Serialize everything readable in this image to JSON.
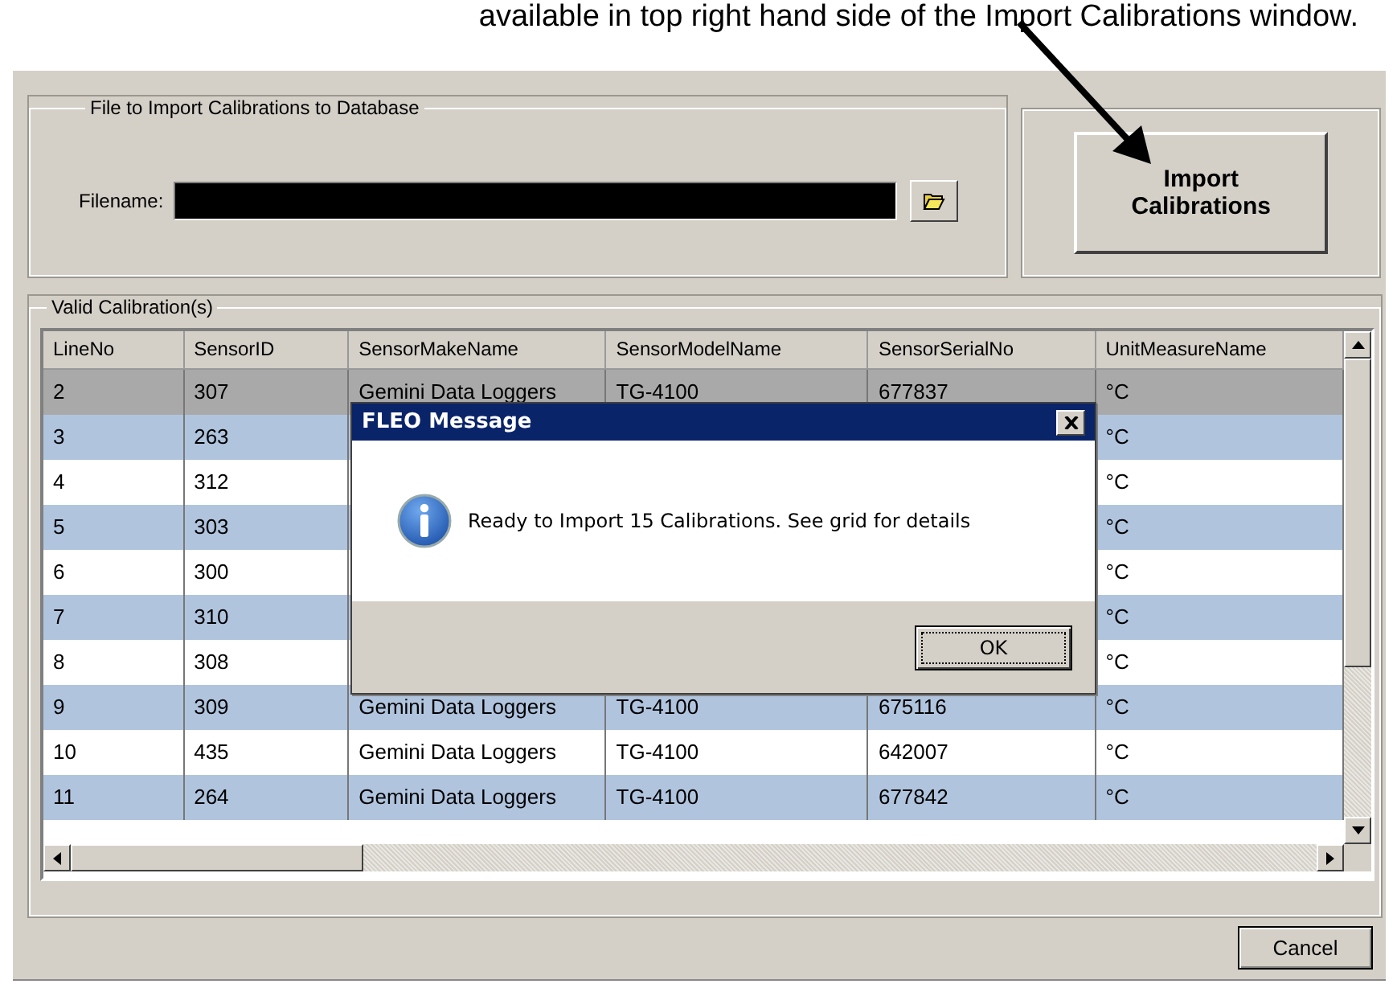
{
  "caption": "available in top right hand side of the Import Calibrations window.",
  "file_group": {
    "title": "File to Import Calibrations to Database",
    "label": "Filename:"
  },
  "import_button": "Import Calibrations",
  "grid_group": {
    "title": "Valid Calibration(s)"
  },
  "table": {
    "columns": [
      "LineNo",
      "SensorID",
      "SensorMakeName",
      "SensorModelName",
      "SensorSerialNo",
      "UnitMeasureName"
    ],
    "rows": [
      {
        "cells": [
          "2",
          "307",
          "Gemini Data Loggers",
          "TG-4100",
          "677837",
          "°C"
        ],
        "selected": true
      },
      {
        "cells": [
          "3",
          "263",
          null,
          null,
          null,
          "°C"
        ],
        "selected": false
      },
      {
        "cells": [
          "4",
          "312",
          null,
          null,
          null,
          "°C"
        ],
        "selected": false
      },
      {
        "cells": [
          "5",
          "303",
          null,
          null,
          null,
          "°C"
        ],
        "selected": false
      },
      {
        "cells": [
          "6",
          "300",
          null,
          null,
          null,
          "°C"
        ],
        "selected": false
      },
      {
        "cells": [
          "7",
          "310",
          null,
          null,
          null,
          "°C"
        ],
        "selected": false
      },
      {
        "cells": [
          "8",
          "308",
          null,
          null,
          null,
          "°C"
        ],
        "selected": false
      },
      {
        "cells": [
          "9",
          "309",
          "Gemini Data Loggers",
          "TG-4100",
          "675116",
          "°C"
        ],
        "selected": false
      },
      {
        "cells": [
          "10",
          "435",
          "Gemini Data Loggers",
          "TG-4100",
          "642007",
          "°C"
        ],
        "selected": false
      },
      {
        "cells": [
          "11",
          "264",
          "Gemini Data Loggers",
          "TG-4100",
          "677842",
          "°C"
        ],
        "selected": false
      }
    ]
  },
  "cancel_button": "Cancel",
  "dialog": {
    "title": "FLEO Message",
    "message": "Ready to Import 15 Calibrations. See grid for details",
    "ok_button": "OK"
  }
}
